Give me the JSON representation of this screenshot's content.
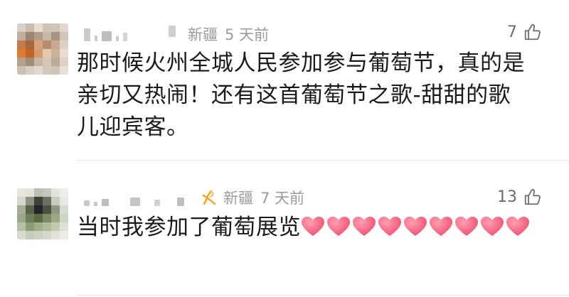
{
  "comments": [
    {
      "location": "新疆",
      "time": "5 天前",
      "likes": "7",
      "text": "那时候火州全城人民参加参与葡萄节，真的是亲切又热闹！还有这首葡萄节之歌-甜甜的歌儿迎宾客。"
    },
    {
      "location": "新疆",
      "time": "7 天前",
      "likes": "13",
      "text": "当时我参加了葡萄展览",
      "heart_count": 9
    }
  ],
  "colors": {
    "meta_text": "#9b9b9b",
    "heart": "#f0506e",
    "badge": "#f5a623"
  },
  "icons": {
    "like": "thumb-up-icon",
    "badge": "member-badge-icon",
    "heart": "heart-emoji"
  }
}
